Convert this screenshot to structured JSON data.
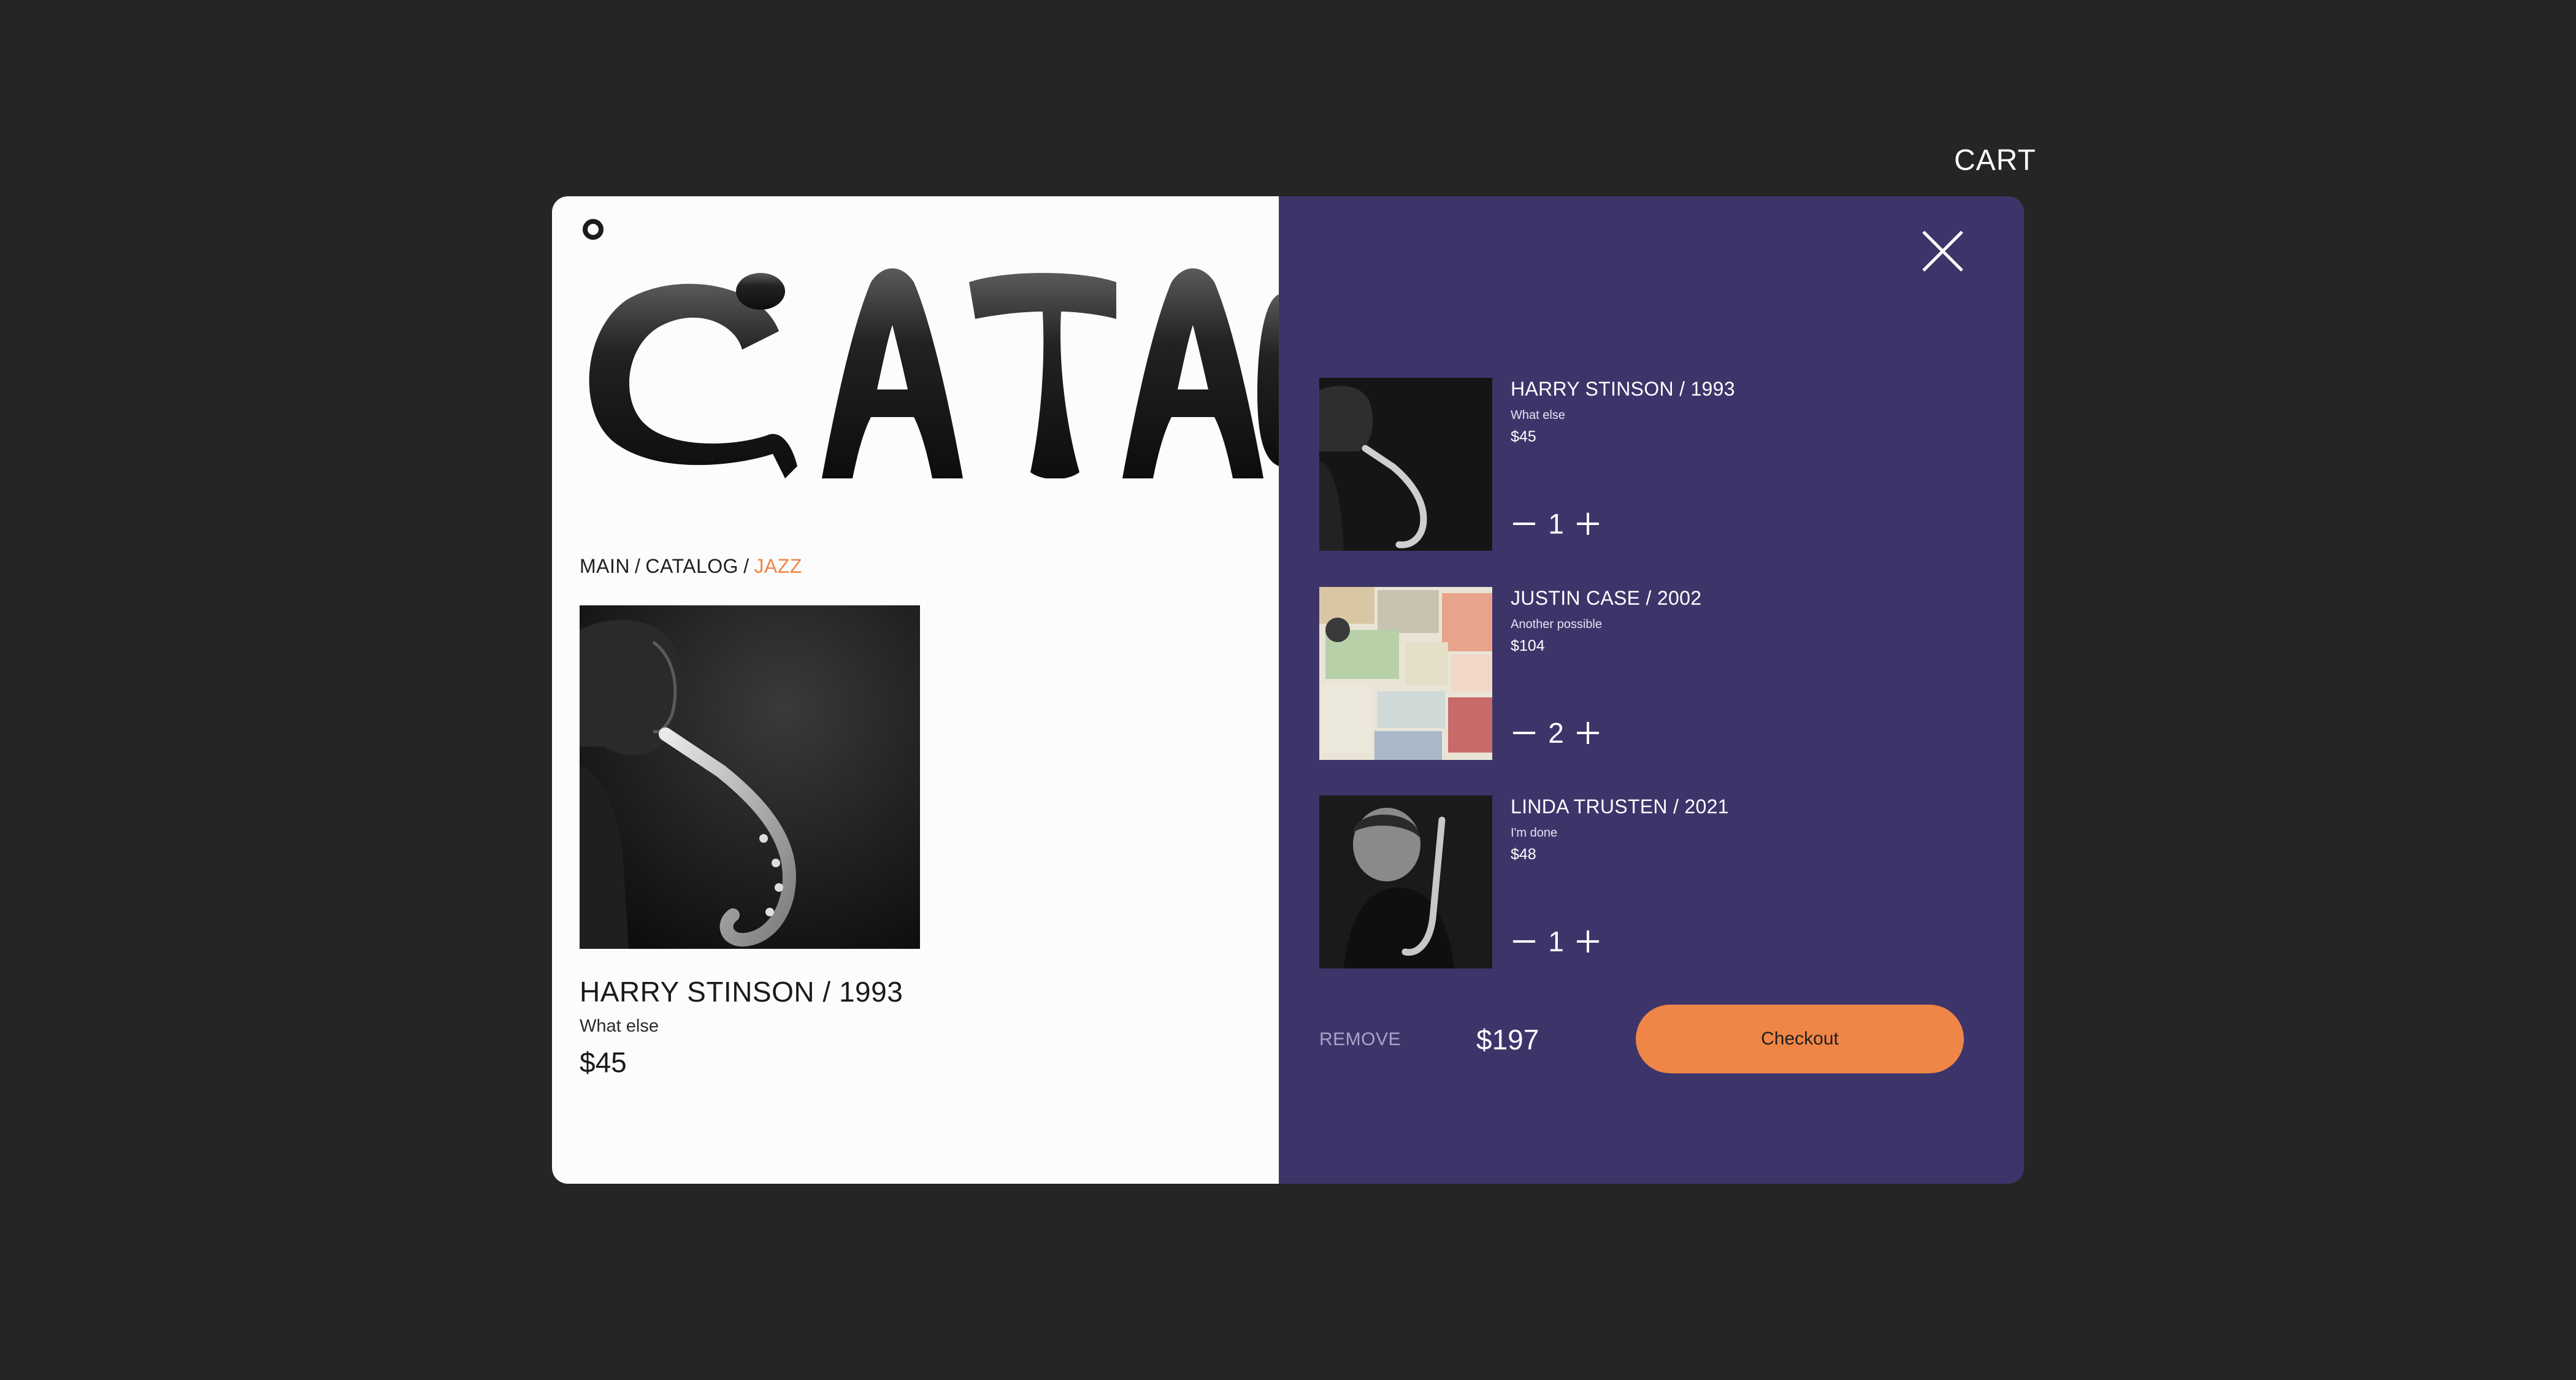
{
  "header": {
    "cart_label": "CART"
  },
  "catalog": {
    "hero_word": "CATALOG",
    "breadcrumb": {
      "items": [
        "MAIN",
        "CATALOG",
        "JAZZ"
      ],
      "separator": "/"
    },
    "product": {
      "title": "HARRY STINSON / 1993",
      "subtitle": "What else",
      "price": "$45"
    }
  },
  "cart": {
    "items": [
      {
        "title": "HARRY STINSON / 1993",
        "subtitle": "What else",
        "price": "$45",
        "quantity": "1"
      },
      {
        "title": "JUSTIN CASE / 2002",
        "subtitle": "Another possible",
        "price": "$104",
        "quantity": "2"
      },
      {
        "title": "LINDA TRUSTEN / 2021",
        "subtitle": "I'm done",
        "price": "$48",
        "quantity": "1"
      }
    ],
    "remove_label": "REMOVE",
    "total": "$197",
    "checkout_label": "Checkout"
  },
  "colors": {
    "background": "#252525",
    "panel_light": "#fcfcfc",
    "cart_panel": "#3d356a",
    "accent": "#ef8546"
  },
  "icons": {
    "logo": "ring-logo-icon",
    "close": "close-icon",
    "minus": "minus-icon",
    "plus": "plus-icon"
  }
}
